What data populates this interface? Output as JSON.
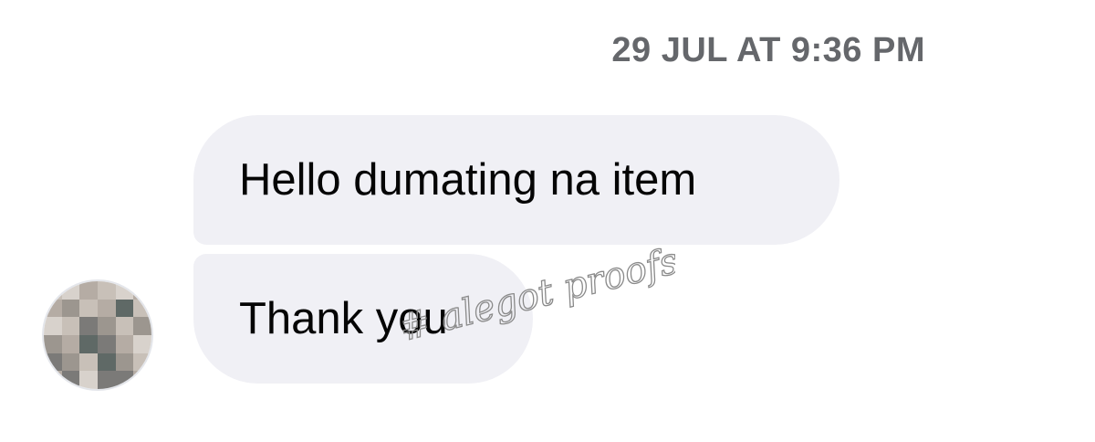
{
  "conversation": {
    "timestamp": "29 JUL AT 9:36 PM",
    "messages": [
      {
        "text": "Hello dumating na item"
      },
      {
        "text": "Thank you"
      }
    ]
  },
  "avatar": {
    "icon": "pixelated-avatar",
    "colors": [
      "#c8c0b8",
      "#9c968f",
      "#7b7a78",
      "#b5aca4",
      "#5f6966",
      "#d8d2cc"
    ]
  },
  "watermark": {
    "text": "# alegot proofs"
  },
  "colors": {
    "bubble": "#f0f0f5",
    "timestamp": "#65676b",
    "message_text": "#050505"
  }
}
